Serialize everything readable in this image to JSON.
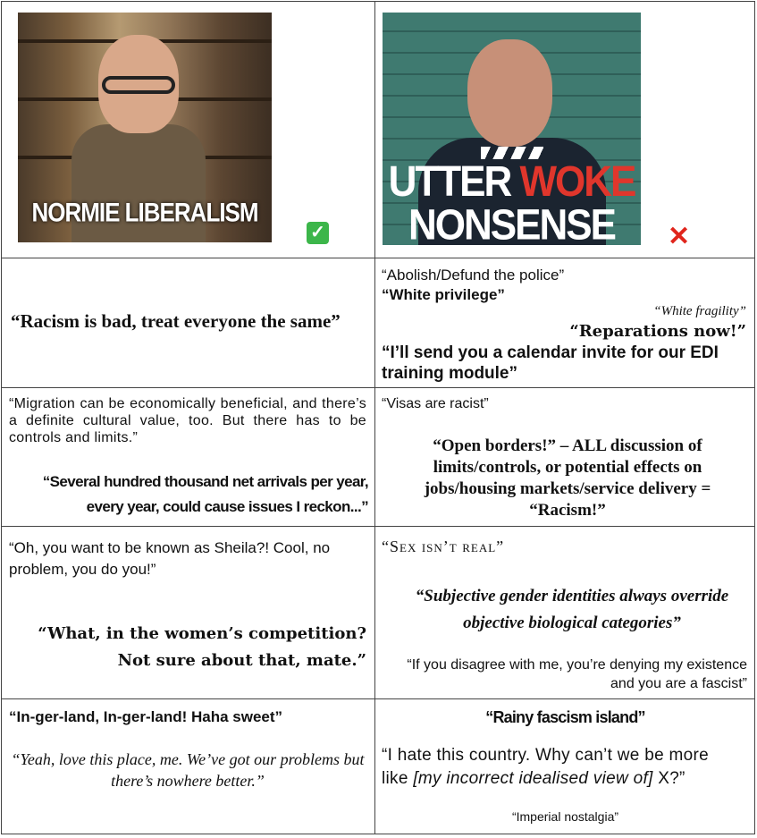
{
  "header": {
    "left_image_caption": "NORMIE LIBERALISM",
    "right_image_caption_part1": "UTTER",
    "right_image_caption_part2": "WOKE",
    "right_image_caption_part3": "NONSENSE",
    "left_mark": "✓",
    "right_mark": "✕",
    "colors": {
      "check": "#3cb64a",
      "cross": "#e0251c",
      "woke_red": "#e0362c"
    }
  },
  "rows": [
    {
      "left": [
        "“Racism is bad, treat everyone the same”"
      ],
      "right": [
        "“Abolish/Defund the police”",
        "“White privilege”",
        "“White fragility”",
        "“Reparations now!”",
        "“I’ll send you a calendar invite for our EDI training module”"
      ]
    },
    {
      "left": [
        "“Migration can be economically beneficial, and there’s a definite cultural value, too. But there has to be controls and limits.”",
        "“Several hundred thousand net arrivals per year, every year, could cause issues I reckon...”"
      ],
      "right": [
        "“Visas are racist”",
        "“Open borders!” – ALL discussion of limits/controls, or potential effects on jobs/housing markets/service delivery = “Racism!”"
      ]
    },
    {
      "left": [
        "“Oh, you want to be known as Sheila?! Cool, no problem, you do you!”",
        "“What, in the women’s competition? Not sure about that, mate.”"
      ],
      "right": [
        "“Sex isn’t real”",
        "“Subjective gender identities always override objective biological categories”",
        "“If you disagree with me, you’re denying my existence and you are a fascist”"
      ]
    },
    {
      "left": [
        "“In-ger-land, In-ger-land! Haha sweet”",
        "“Yeah, love this place, me. We’ve got our problems but there’s nowhere better.”"
      ],
      "right": [
        "“Rainy fascism island”",
        "“I hate this country. Why can’t we be more like",
        "[my incorrect idealised view of]",
        "X?”",
        "“Imperial nostalgia”"
      ]
    }
  ]
}
